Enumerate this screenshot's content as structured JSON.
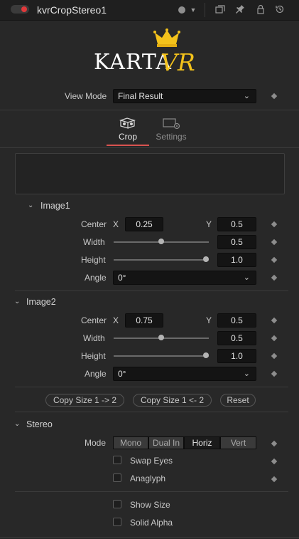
{
  "header": {
    "title": "kvrCropStereo1"
  },
  "logo": {
    "part1": "KARTA",
    "part2": "VR"
  },
  "view_mode": {
    "label": "View Mode",
    "value": "Final Result"
  },
  "tabs": [
    {
      "label": "Crop",
      "active": true
    },
    {
      "label": "Settings",
      "active": false
    }
  ],
  "image1": {
    "title": "Image1",
    "center_label": "Center",
    "x_label": "X",
    "x_value": "0.25",
    "y_label": "Y",
    "y_value": "0.5",
    "width_label": "Width",
    "width_value": "0.5",
    "height_label": "Height",
    "height_value": "1.0",
    "angle_label": "Angle",
    "angle_value": "0°"
  },
  "image2": {
    "title": "Image2",
    "center_label": "Center",
    "x_label": "X",
    "x_value": "0.75",
    "y_label": "Y",
    "y_value": "0.5",
    "width_label": "Width",
    "width_value": "0.5",
    "height_label": "Height",
    "height_value": "1.0",
    "angle_label": "Angle",
    "angle_value": "0°"
  },
  "buttons": {
    "copy_1_to_2": "Copy Size 1 -> 2",
    "copy_2_to_1": "Copy Size 1 <- 2",
    "reset": "Reset"
  },
  "stereo": {
    "title": "Stereo",
    "mode_label": "Mode",
    "modes": [
      "Mono",
      "Dual In",
      "Horiz",
      "Vert"
    ],
    "active_mode": "Horiz",
    "swap_eyes": "Swap Eyes",
    "anaglyph": "Anaglyph"
  },
  "options": {
    "show_size": "Show Size",
    "solid_alpha": "Solid Alpha"
  },
  "colors": {
    "accent_red": "#e0393b",
    "tab_underline": "#d9534f",
    "logo_gold": "#f3c21b"
  }
}
